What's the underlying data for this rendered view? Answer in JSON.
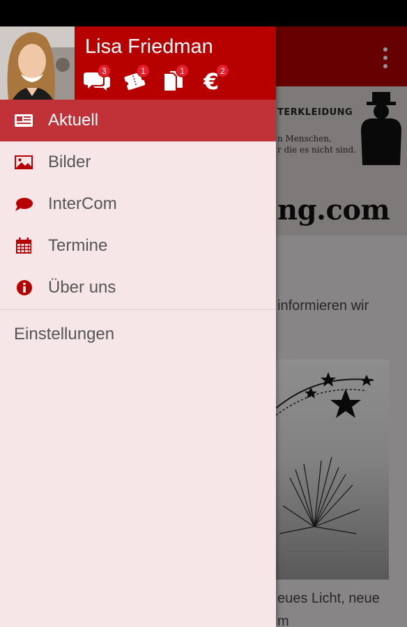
{
  "user": {
    "name": "Lisa Friedman"
  },
  "header_icons": [
    {
      "icon": "chat-bubbles-icon",
      "badge": "3"
    },
    {
      "icon": "tickets-icon",
      "badge": "1"
    },
    {
      "icon": "documents-icon",
      "badge": "1"
    },
    {
      "icon": "euro-icon",
      "badge": "2"
    }
  ],
  "menu": {
    "items": [
      {
        "label": "Aktuell",
        "icon": "newspaper-icon",
        "active": true
      },
      {
        "label": "Bilder",
        "icon": "image-icon",
        "active": false
      },
      {
        "label": "InterCom",
        "icon": "speech-bubble-icon",
        "active": false
      },
      {
        "label": "Termine",
        "icon": "calendar-icon",
        "active": false
      },
      {
        "label": "Über uns",
        "icon": "info-icon",
        "active": false
      }
    ],
    "settings_label": "Einstellungen"
  },
  "background": {
    "banner_title": "TERKLEIDUNG",
    "banner_line1": "n Menschen,",
    "banner_line2": "r die es nicht sind.",
    "banner_domain": "ng.com",
    "text_line1": "informieren wir",
    "text_line2": "",
    "caption_line1": "eues Licht, neue",
    "caption_line2": "m"
  },
  "colors": {
    "brand_red": "#b70000",
    "active_item": "#c13238",
    "drawer_bg": "#f6e6e7",
    "badge_red": "#e3202c"
  }
}
